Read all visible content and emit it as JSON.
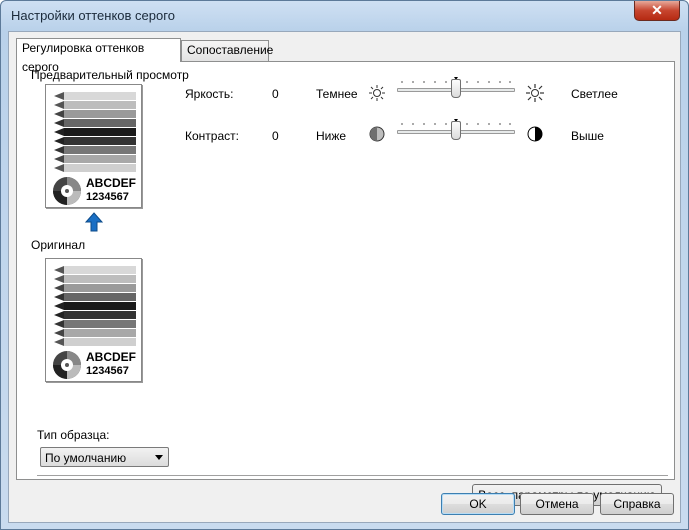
{
  "window": {
    "title": "Настройки оттенков серого",
    "close_label": "✕"
  },
  "tabs": [
    {
      "label": "Регулировка оттенков серого",
      "active": true
    },
    {
      "label": "Сопоставление",
      "active": false
    }
  ],
  "preview": {
    "label": "Предварительный просмотр",
    "sample_letters": "ABCDEF",
    "sample_numbers": "1234567"
  },
  "original": {
    "label": "Оригинал",
    "sample_letters": "ABCDEF",
    "sample_numbers": "1234567"
  },
  "brightness": {
    "label": "Яркость:",
    "value": "0",
    "min_label": "Темнее",
    "max_label": "Светлее",
    "min_icon": "sun-dim-icon",
    "max_icon": "sun-bright-icon",
    "level": 0.5
  },
  "contrast": {
    "label": "Контраст:",
    "value": "0",
    "min_label": "Ниже",
    "max_label": "Выше",
    "min_icon": "contrast-low-icon",
    "max_icon": "contrast-high-icon",
    "level": 0.5
  },
  "sample_type": {
    "label": "Тип образца:",
    "selected": "По умолчанию"
  },
  "buttons": {
    "restore_defaults": "Восс. параметры по умолчанию",
    "ok": "OK",
    "cancel": "Отмена",
    "help": "Справка"
  },
  "colors": {
    "arrow": "#1a6fc4"
  }
}
